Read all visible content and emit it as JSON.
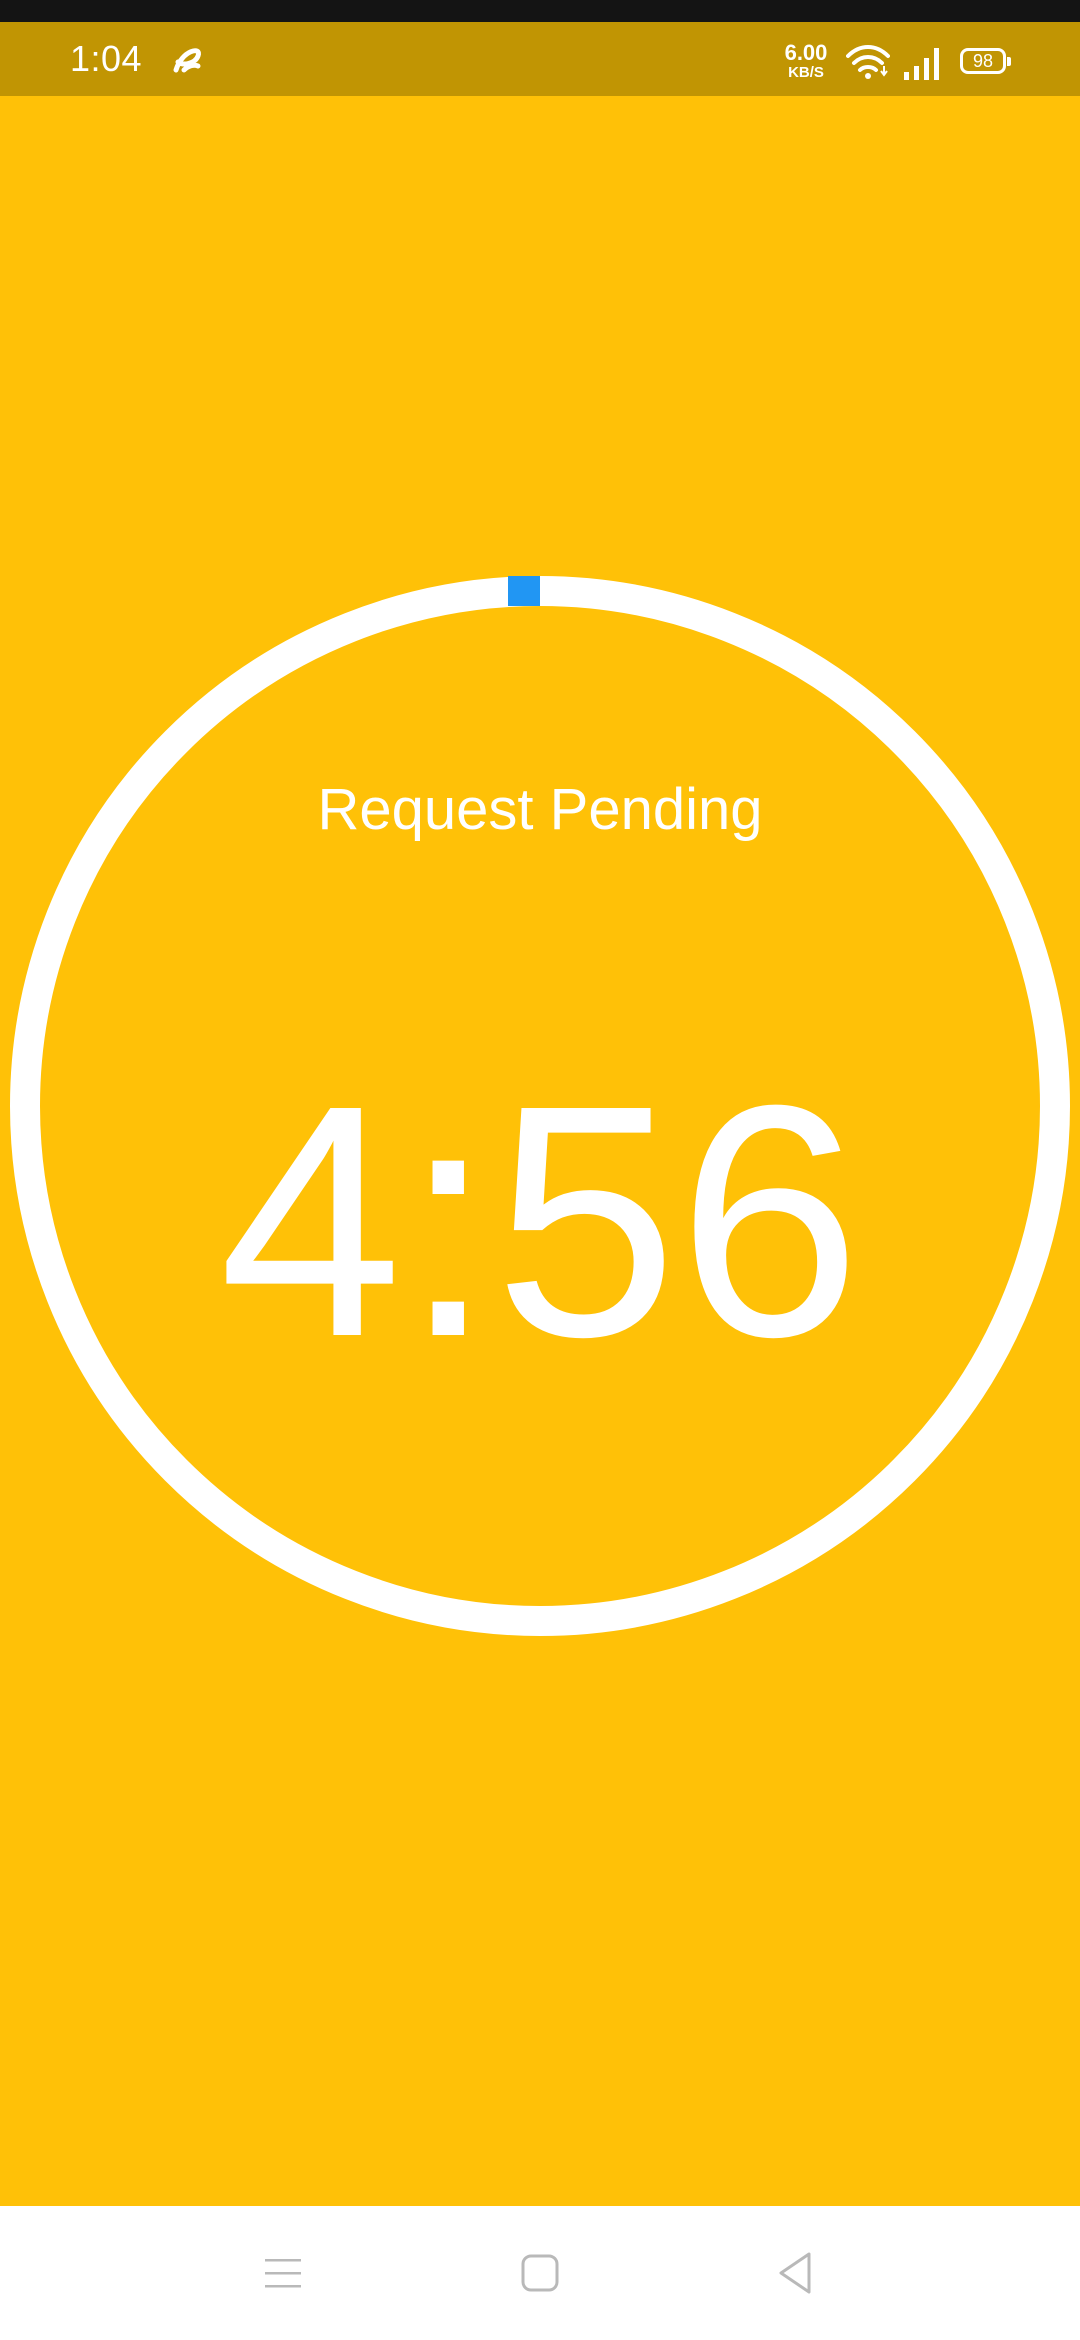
{
  "status_bar": {
    "time": "1:04",
    "net_speed_value": "6.00",
    "net_speed_unit": "KB/S",
    "battery_level": "98",
    "icons": [
      "carrier-icon",
      "wifi-icon",
      "signal-icon",
      "battery-icon"
    ]
  },
  "timer": {
    "status_label": "Request Pending",
    "countdown": "4:56",
    "ring_color": "#FFFFFF",
    "progress_color": "#2196F3"
  },
  "colors": {
    "background": "#FFC107",
    "status_bar": "#C19503",
    "nav_bar": "#FFFFFF"
  },
  "nav_bar": {
    "buttons": [
      "menu-icon",
      "home-icon",
      "back-icon"
    ]
  }
}
